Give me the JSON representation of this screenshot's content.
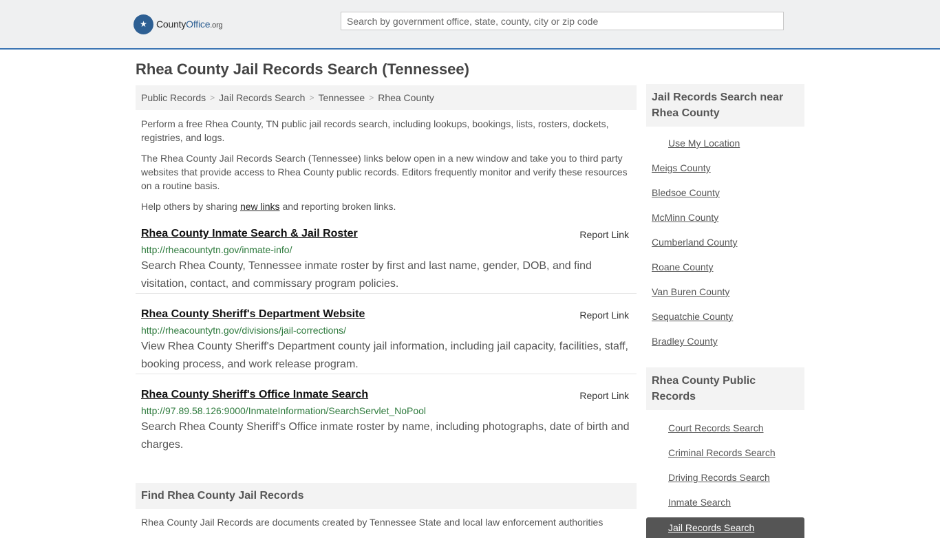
{
  "header": {
    "logo": {
      "brand_a": "County",
      "brand_b": "Office",
      "tld": ".org"
    },
    "search_placeholder": "Search by government office, state, county, city or zip code"
  },
  "page_title": "Rhea County Jail Records Search (Tennessee)",
  "breadcrumb": [
    "Public Records",
    "Jail Records Search",
    "Tennessee",
    "Rhea County"
  ],
  "intro": {
    "p1": "Perform a free Rhea County, TN public jail records search, including lookups, bookings, lists, rosters, dockets, registries, and logs.",
    "p2": "The Rhea County Jail Records Search (Tennessee) links below open in a new window and take you to third party websites that provide access to Rhea County public records. Editors frequently monitor and verify these resources on a routine basis.",
    "p3_before": "Help others by sharing ",
    "p3_link": "new links",
    "p3_after": " and reporting broken links."
  },
  "report_label": "Report Link",
  "entries": [
    {
      "title": "Rhea County Inmate Search & Jail Roster",
      "url": "http://rheacountytn.gov/inmate-info/",
      "desc": "Search Rhea County, Tennessee inmate roster by first and last name, gender, DOB, and find visitation, contact, and commissary program policies."
    },
    {
      "title": "Rhea County Sheriff's Department Website",
      "url": "http://rheacountytn.gov/divisions/jail-corrections/",
      "desc": "View Rhea County Sheriff's Department county jail information, including jail capacity, facilities, staff, booking process, and work release program."
    },
    {
      "title": "Rhea County Sheriff's Office Inmate Search",
      "url": "http://97.89.58.126:9000/InmateInformation/SearchServlet_NoPool",
      "desc": "Search Rhea County Sheriff's Office inmate roster by name, including photographs, date of birth and charges."
    }
  ],
  "find_heading": "Find Rhea County Jail Records",
  "find_text": "Rhea County Jail Records are documents created by Tennessee State and local law enforcement authorities",
  "sidebar": {
    "nearby_heading": "Jail Records Search near Rhea County",
    "use_location": "Use My Location",
    "nearby": [
      "Meigs County",
      "Bledsoe County",
      "McMinn County",
      "Cumberland County",
      "Roane County",
      "Van Buren County",
      "Sequatchie County",
      "Bradley County"
    ],
    "records_heading": "Rhea County Public Records",
    "records": [
      "Court Records Search",
      "Criminal Records Search",
      "Driving Records Search",
      "Inmate Search"
    ],
    "active": "Jail Records Search"
  },
  "colors": {
    "accent": "#3d76b4",
    "link_green": "#2d7a3c",
    "logo_blue": "#2d5f93"
  }
}
